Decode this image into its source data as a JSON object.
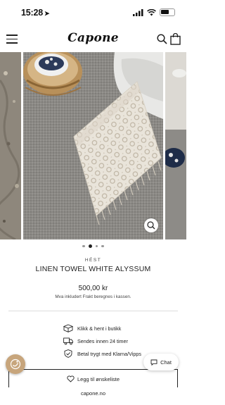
{
  "status": {
    "time": "15:28",
    "location_glyph": "➤"
  },
  "header": {
    "logo": "Capone",
    "menu_icon": "hamburger-menu-icon",
    "search_icon": "search-icon",
    "bag_icon": "shopping-bag-icon"
  },
  "gallery": {
    "slides_count": 4,
    "active_index": 1,
    "zoom_icon": "zoom-icon"
  },
  "product": {
    "brand": "HÉST",
    "title": "LINEN TOWEL WHITE ALYSSUM",
    "price": "500,00 kr",
    "tax_note": "Mva inkludert Frakt beregnes i kassen."
  },
  "features": [
    {
      "icon": "box-icon",
      "text": "Klikk & hent i butikk"
    },
    {
      "icon": "truck-icon",
      "text": "Sendes innen 24 timer"
    },
    {
      "icon": "shield-check-icon",
      "text": "Betal trygt med Klarna/Vipps"
    }
  ],
  "wishlist": {
    "label": "Legg til ønskeliste",
    "icon": "heart-icon"
  },
  "chat": {
    "label": "Chat",
    "icon": "chat-bubble-icon"
  },
  "accessibility": {
    "icon": "accessibility-icon"
  },
  "browser": {
    "url": "capone.no"
  },
  "colors": {
    "accent": "#c7a57c",
    "text": "#222222",
    "divider": "#dddddd"
  }
}
